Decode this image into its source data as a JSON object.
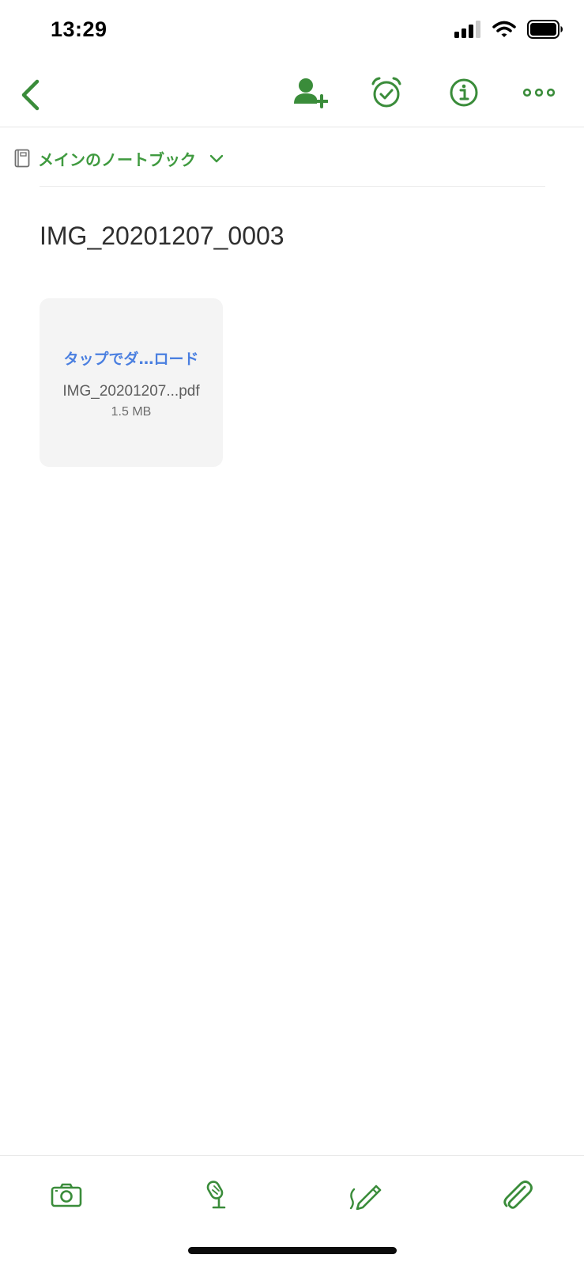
{
  "status_bar": {
    "time": "13:29",
    "icons": [
      "signal-icon",
      "wifi-icon",
      "battery-icon"
    ]
  },
  "nav": {
    "icons": [
      "back-chevron-icon",
      "add-person-icon",
      "alarm-check-icon",
      "info-icon",
      "more-dots-icon"
    ]
  },
  "notebook": {
    "label": "メインのノートブック",
    "icon": "notebook-icon"
  },
  "note": {
    "title": "IMG_20201207_0003"
  },
  "attachment": {
    "action_text": "タップでダ…ロード",
    "file_name": "IMG_20201207...pdf",
    "file_size": "1.5 MB"
  },
  "toolbar": {
    "icons": [
      "camera-icon",
      "microphone-icon",
      "pen-icon",
      "paperclip-icon"
    ]
  },
  "colors": {
    "accent_green": "#3f8f3f",
    "link_blue": "#4a7fe0",
    "card_bg": "#f4f4f4"
  }
}
